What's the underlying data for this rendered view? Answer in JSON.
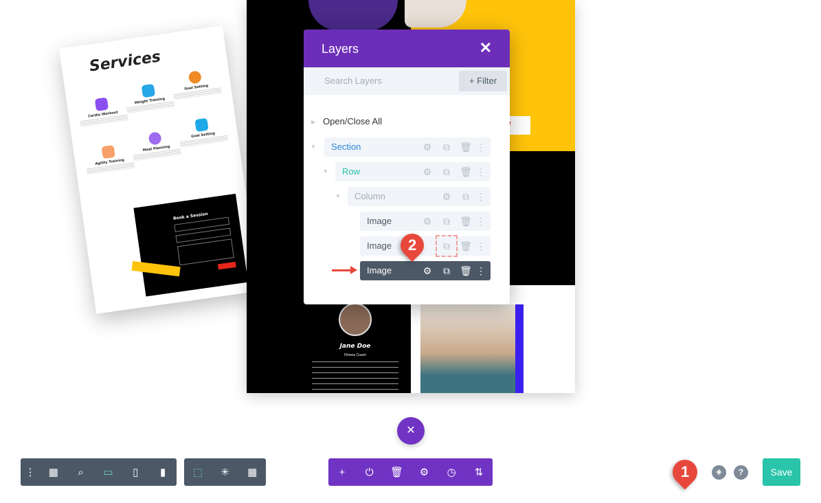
{
  "mockup": {
    "title": "Services",
    "services": [
      "Cardio Workout",
      "Weight Training",
      "Goal Setting",
      "Agility Training",
      "Meal Planning",
      "Goal Setting"
    ],
    "form_title": "Book a Session"
  },
  "preview": {
    "profile_name": "Jane Doe",
    "profile_role": "Fitness Coach",
    "button_fragment": "ail"
  },
  "layers": {
    "title": "Layers",
    "close": "✕",
    "search_placeholder": "Search Layers",
    "filter_label": "+ Filter",
    "open_close_all": "Open/Close All",
    "items": [
      {
        "label": "Section",
        "color": "#2b87da"
      },
      {
        "label": "Row",
        "color": "#29c4a9"
      },
      {
        "label": "Column",
        "color": "#a3acb8"
      },
      {
        "label": "Image"
      },
      {
        "label": "Image"
      },
      {
        "label": "Image",
        "selected": true
      }
    ]
  },
  "icons": {
    "settings": "⚙",
    "duplicate": "⧉",
    "delete": "🗑",
    "more": "⋮"
  },
  "callouts": {
    "one": "1",
    "two": "2"
  },
  "toolbar": {
    "left": [
      "⋮",
      "▦",
      "⌕",
      "▭",
      "▯",
      "▮"
    ],
    "mid": [
      "⬚",
      "✳",
      "▦"
    ],
    "page": [
      "+",
      "⏻",
      "🗑",
      "⚙",
      "◷",
      "⇅"
    ],
    "close": "✕",
    "save": "Save",
    "help": "?",
    "layers": "◈"
  },
  "colors": {
    "purple": "#6c2eb9",
    "save": "#29c4a9",
    "dark": "#4c5866",
    "callout": "#e8483c",
    "yellow": "#ffc40a"
  }
}
